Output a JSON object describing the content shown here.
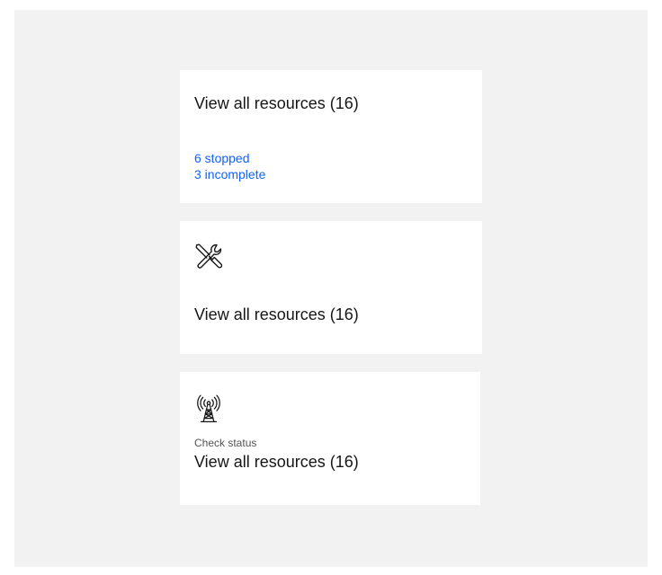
{
  "tiles": [
    {
      "title": "View all resources (16)",
      "links": [
        "6 stopped",
        "3 incomplete"
      ],
      "link_color": "#0f62fe"
    },
    {
      "icon": "tools-icon",
      "title": "View all resources (16)"
    },
    {
      "icon": "radio-tower-icon",
      "caption": "Check status",
      "title": "View all resources (16)"
    }
  ],
  "colors": {
    "background": "#f2f2f2",
    "tile": "#ffffff",
    "text": "#161616",
    "link": "#0f62fe"
  }
}
